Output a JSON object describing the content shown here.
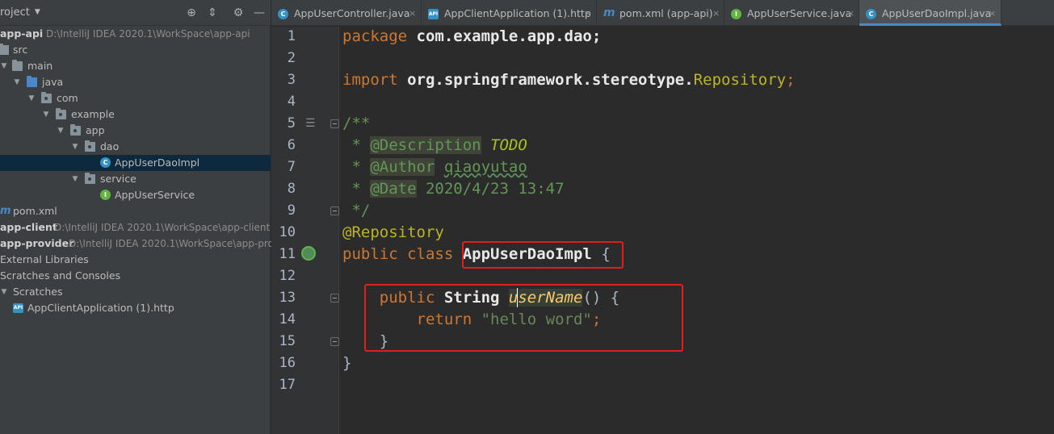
{
  "project_panel": {
    "title": "roject",
    "tree": [
      {
        "label": "app-api",
        "path": "D:\\IntelliJ IDEA 2020.1\\WorkSpace\\app-api"
      },
      {
        "label": "src"
      },
      {
        "label": "main"
      },
      {
        "label": "java"
      },
      {
        "label": "com"
      },
      {
        "label": "example"
      },
      {
        "label": "app"
      },
      {
        "label": "dao"
      },
      {
        "label": "AppUserDaoImpl"
      },
      {
        "label": "service"
      },
      {
        "label": "AppUserService"
      },
      {
        "label": "pom.xml"
      },
      {
        "label": "app-client",
        "path": "D:\\IntelliJ IDEA 2020.1\\WorkSpace\\app-client"
      },
      {
        "label": "app-provider",
        "path": "D:\\IntelliJ IDEA 2020.1\\WorkSpace\\app-pro"
      },
      {
        "label": "External Libraries"
      },
      {
        "label": "Scratches and Consoles"
      },
      {
        "label": "Scratches"
      },
      {
        "label": "AppClientApplication (1).http"
      }
    ]
  },
  "tabs": [
    {
      "label": "AppUserController.java",
      "icon": "class-icon"
    },
    {
      "label": "AppClientApplication (1).http",
      "icon": "http-icon"
    },
    {
      "label": "pom.xml (app-api)",
      "icon": "maven-icon"
    },
    {
      "label": "AppUserService.java",
      "icon": "interface-icon"
    },
    {
      "label": "AppUserDaoImpl.java",
      "icon": "class-icon",
      "active": true
    }
  ],
  "editor": {
    "line_numbers": [
      "1",
      "2",
      "3",
      "4",
      "5",
      "6",
      "7",
      "8",
      "9",
      "10",
      "11",
      "12",
      "13",
      "14",
      "15",
      "16",
      "17"
    ],
    "line1": {
      "kw": "package",
      "rest": " com.example.app.dao;"
    },
    "line3": {
      "kw": "import",
      "pkg": " org.springframework.stereotype.",
      "cls": "Repository",
      "end": ";"
    },
    "line5": "/**",
    "line6": {
      "prefix": " * ",
      "tag": "@Description",
      "sp": " ",
      "todo": "TODO"
    },
    "line7": {
      "prefix": " * ",
      "tag": "@Author",
      "sp": " ",
      "value": "qiaoyutao"
    },
    "line8": {
      "prefix": " * ",
      "tag": "@Date",
      "value": " 2020/4/23 13:47"
    },
    "line9": " */",
    "line10": "@Repository",
    "line11": {
      "kw": "public class ",
      "name": "AppUserDaoImpl",
      "brace": " {"
    },
    "line13": {
      "indent": "    ",
      "kw": "public ",
      "type": "String ",
      "method": "userName",
      "rest": "() {"
    },
    "line14": {
      "indent": "        ",
      "kw": "return ",
      "str": "\"hello word\"",
      "end": ";"
    },
    "line15": "    }",
    "line16": "}"
  }
}
